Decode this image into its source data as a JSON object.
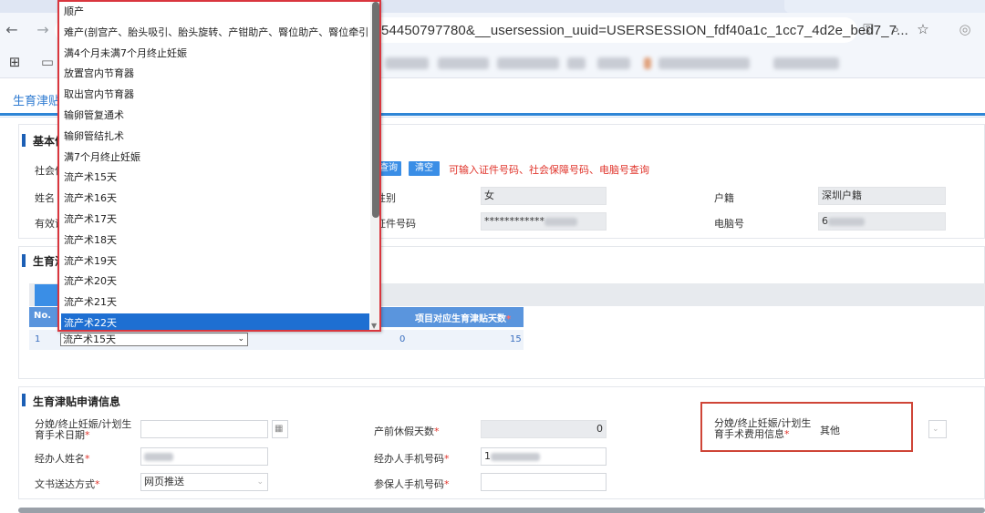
{
  "browser": {
    "url_visible": "54450797780&__usersession_uuid=USERSESSION_fdf40a1c_1cc7_4d2e_bed7_7...",
    "icons": [
      "back-icon",
      "forward-icon",
      "key-icon",
      "zoom-icon",
      "star-icon",
      "extension-icon",
      "apps-icon",
      "folder-icon"
    ]
  },
  "page": {
    "tab_title": "生育津贴"
  },
  "basic_info": {
    "title": "基本信",
    "ssn_label": "社会保",
    "query_button": "查询",
    "clear_button": "清空",
    "hint": "可输入证件号码、社会保障号码、电脑号查询",
    "name_label": "姓名",
    "gender_label": "性别",
    "gender_value": "女",
    "huji_label": "户籍",
    "huji_value": "深圳户籍",
    "valid_id_label": "有效证",
    "id_number_label": "证件号码",
    "id_number_value": "************",
    "pc_number_label": "电脑号",
    "pc_number_value": "6"
  },
  "project_section": {
    "title": "生育津",
    "table": {
      "headers": [
        "No.",
        "项目对应生育津贴天数"
      ],
      "rows": [
        {
          "no": "1",
          "project": "流产术15天",
          "col3": "0",
          "days": "15"
        }
      ]
    }
  },
  "dropdown": {
    "items": [
      "顺产",
      "难产(剖宫产、胎头吸引、胎头旋转、产钳助产、臀位助产、臀位牵引)",
      "满4个月未满7个月终止妊娠",
      "放置宫内节育器",
      "取出宫内节育器",
      "输卵管复通术",
      "输卵管结扎术",
      "满7个月终止妊娠",
      "流产术15天",
      "流产术16天",
      "流产术17天",
      "流产术18天",
      "流产术19天",
      "流产术20天",
      "流产术21天",
      "流产术22天"
    ],
    "selected": "流产术22天"
  },
  "application": {
    "title": "生育津贴申请信息",
    "date_label": "分娩/终止妊娠/计划生育手术日期",
    "prenatal_leave_label": "产前休假天数",
    "prenatal_leave_value": "0",
    "fee_label": "分娩/终止妊娠/计划生育手术费用信息",
    "fee_value": "其他",
    "agent_name_label": "经办人姓名",
    "agent_phone_label": "经办人手机号码",
    "agent_phone_value": "1",
    "delivery_label": "文书送达方式",
    "delivery_value": "网页推送",
    "insured_phone_label": "参保人手机号码"
  }
}
